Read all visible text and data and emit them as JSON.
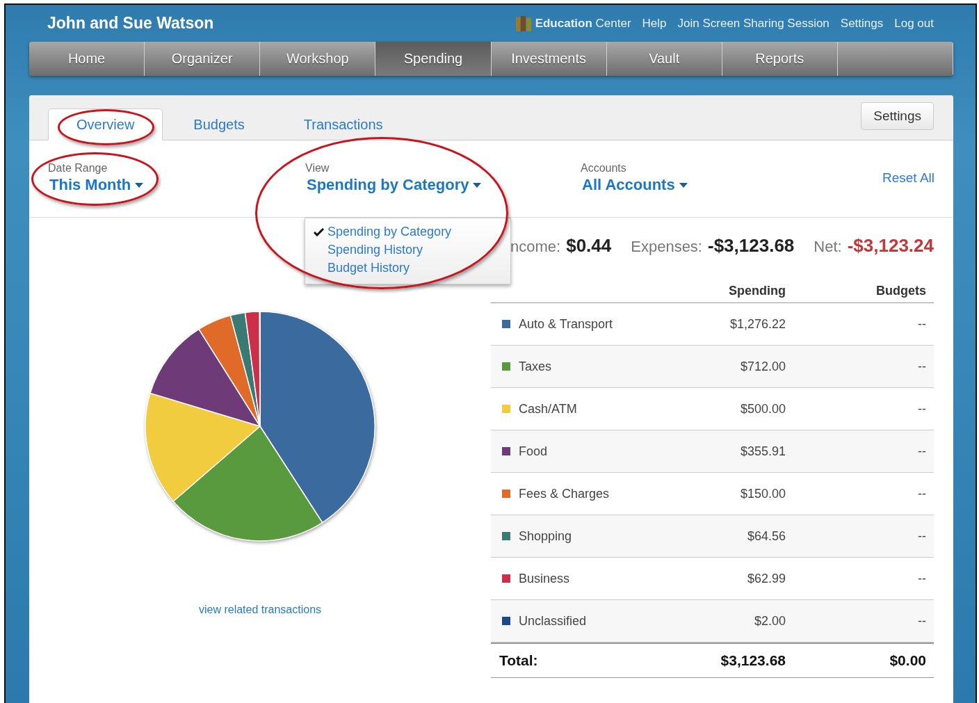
{
  "header": {
    "user": "John and Sue Watson",
    "links": [
      {
        "text": "**Education** Center",
        "kind": "book"
      },
      {
        "text": "Help",
        "kind": "plain"
      },
      {
        "text": "Join Screen Sharing Session",
        "kind": "plain"
      },
      {
        "text": "Settings",
        "kind": "plain"
      },
      {
        "text": "Log out",
        "kind": "plain"
      }
    ]
  },
  "nav": [
    {
      "label": "Home",
      "selected": false
    },
    {
      "label": "Organizer",
      "selected": false
    },
    {
      "label": "Workshop",
      "selected": false
    },
    {
      "label": "Spending",
      "selected": true
    },
    {
      "label": "Investments",
      "selected": false
    },
    {
      "label": "Vault",
      "selected": false
    },
    {
      "label": "Reports",
      "selected": false
    }
  ],
  "tabs": [
    {
      "label": "Overview",
      "selected": true
    },
    {
      "label": "Budgets",
      "selected": false
    },
    {
      "label": "Transactions",
      "selected": false
    }
  ],
  "settings_button": "Settings",
  "filters": {
    "date_range": {
      "label": "Date Range",
      "value": "This Month"
    },
    "view": {
      "label": "View",
      "value": "Spending by Category",
      "expanded": true,
      "options": [
        {
          "label": "Spending by Category",
          "selected": true
        },
        {
          "label": "Spending History",
          "selected": false
        },
        {
          "label": "Budget History",
          "selected": false
        }
      ]
    },
    "accounts": {
      "label": "Accounts",
      "value": "All Accounts"
    },
    "reset": "Reset All"
  },
  "summary": [
    {
      "label": "ncome:",
      "value": "$0.44",
      "negative": false
    },
    {
      "label": "Expenses:",
      "value": "-$3,123.68",
      "negative": false
    },
    {
      "label": "Net:",
      "value": "-$3,123.24",
      "negative": true
    }
  ],
  "chart": {
    "link": "view related transactions",
    "chart_data": {
      "type": "pie",
      "values": [
        40.86,
        22.79,
        16.01,
        11.39,
        4.8,
        2.07,
        2.02,
        0.06
      ]
    }
  },
  "table": {
    "columns": [
      "Spending",
      "Budgets"
    ],
    "rows": [
      {
        "name": "Auto & Transport",
        "spending": "$1,276.22",
        "budget": "--",
        "color": "#3a6a9e"
      },
      {
        "name": "Taxes",
        "spending": "$712.00",
        "budget": "--",
        "color": "#5a9a3e"
      },
      {
        "name": "Cash/ATM",
        "spending": "$500.00",
        "budget": "--",
        "color": "#f0cc3e"
      },
      {
        "name": "Food",
        "spending": "$355.91",
        "budget": "--",
        "color": "#6e3a78"
      },
      {
        "name": "Fees & Charges",
        "spending": "$150.00",
        "budget": "--",
        "color": "#e06a28"
      },
      {
        "name": "Shopping",
        "spending": "$64.56",
        "budget": "--",
        "color": "#3a7a72"
      },
      {
        "name": "Business",
        "spending": "$62.99",
        "budget": "--",
        "color": "#cc3048"
      },
      {
        "name": "Unclassified",
        "spending": "$2.00",
        "budget": "--",
        "color": "#1a4a8a"
      }
    ],
    "total": {
      "label": "Total:",
      "spending": "$3,123.68",
      "budget": "$0.00"
    }
  }
}
